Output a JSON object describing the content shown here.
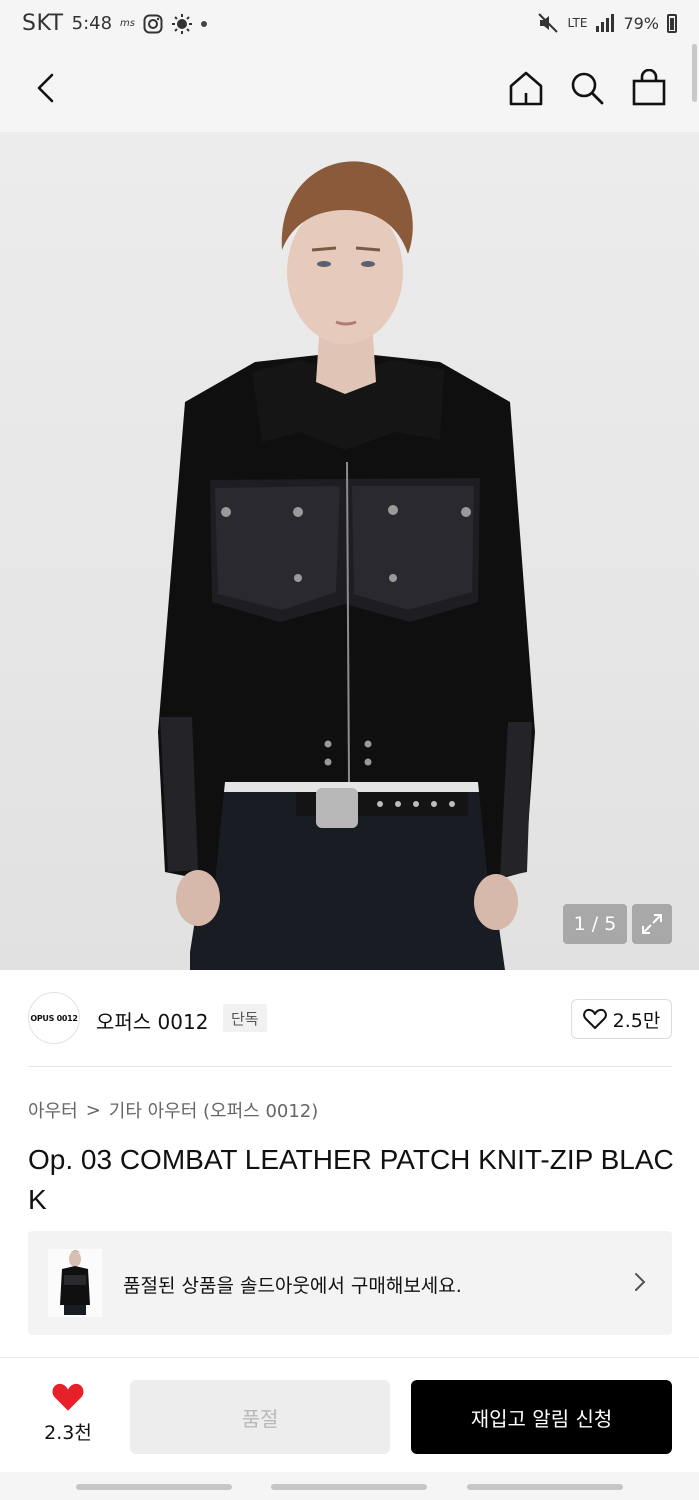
{
  "status_bar": {
    "carrier": "SKT",
    "time": "5:48",
    "notif_text": "ms",
    "network": "LTE",
    "battery": "79%"
  },
  "gallery": {
    "counter": "1 / 5",
    "current_index": 1,
    "total": 5
  },
  "brand": {
    "logo_text": "OPUS 0012",
    "name": "오퍼스 0012",
    "badge": "단독",
    "likes": "2.5만"
  },
  "breadcrumb": {
    "category": "아우터",
    "separator": ">",
    "subcategory": "기타 아우터 (오퍼스 0012)"
  },
  "product": {
    "title": "Op. 03 COMBAT LEATHER PATCH KNIT-ZIP BLACK"
  },
  "soldout_banner": {
    "text": "품절된 상품을 솔드아웃에서 구매해보세요."
  },
  "bottom_bar": {
    "wish_count": "2.3천",
    "soldout_label": "품절",
    "restock_label": "재입고 알림 신청"
  },
  "colors": {
    "heart_red": "#e8202a",
    "primary_black": "#000000",
    "disabled_bg": "#ededed"
  }
}
